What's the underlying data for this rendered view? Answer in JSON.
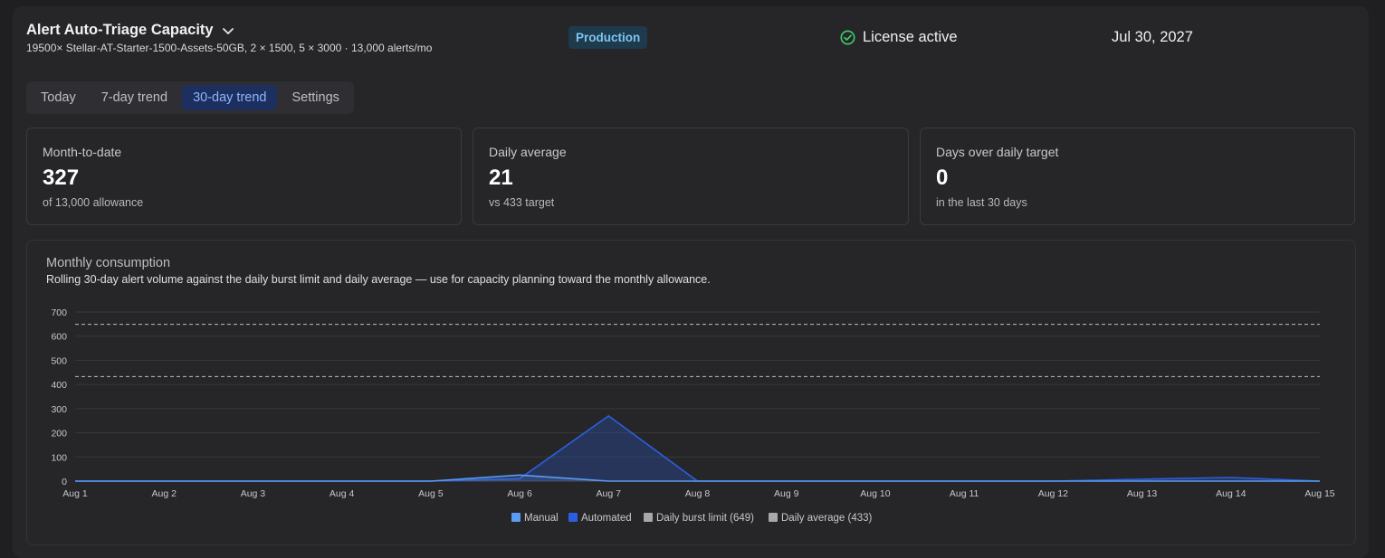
{
  "header": {
    "title": "Alert Auto-Triage Capacity",
    "subtitle": "19500× Stellar-AT-Starter-1500-Assets-50GB, 2 × 1500, 5 × 3000 · 13,000 alerts/mo",
    "environment": "Production",
    "license_status": "License active",
    "date": "Jul 30, 2027"
  },
  "tabs": [
    {
      "label": "Today",
      "active": false
    },
    {
      "label": "7-day trend",
      "active": false
    },
    {
      "label": "30-day trend",
      "active": true
    },
    {
      "label": "Settings",
      "active": false
    }
  ],
  "stats": [
    {
      "label": "Month-to-date",
      "value": "327",
      "note": "of 13,000 allowance"
    },
    {
      "label": "Daily average",
      "value": "21",
      "note": "vs 433 target"
    },
    {
      "label": "Days over daily target",
      "value": "0",
      "note": "in the last 30 days"
    }
  ],
  "chart": {
    "title": "Monthly consumption",
    "description": "Rolling 30-day alert volume against the daily burst limit and daily average — use for capacity planning toward the monthly allowance."
  },
  "colors": {
    "manual": "#5b9bf3",
    "automated": "#2c5fe0",
    "burst_limit": "#a8a8ac",
    "average": "#a8a8ac"
  },
  "chart_data": {
    "type": "area",
    "categories": [
      "Aug 1",
      "Aug 2",
      "Aug 3",
      "Aug 4",
      "Aug 5",
      "Aug 6",
      "Aug 7",
      "Aug 8",
      "Aug 9",
      "Aug 10",
      "Aug 11",
      "Aug 12",
      "Aug 13",
      "Aug 14",
      "Aug 15"
    ],
    "series": [
      {
        "name": "Manual",
        "values": [
          0,
          0,
          0,
          0,
          0,
          25,
          0,
          0,
          0,
          0,
          0,
          0,
          0,
          0,
          0
        ]
      },
      {
        "name": "Automated",
        "values": [
          0,
          0,
          0,
          0,
          0,
          10,
          270,
          0,
          0,
          0,
          0,
          0,
          8,
          15,
          0
        ]
      }
    ],
    "reference_lines": [
      {
        "name": "Daily burst limit (649)",
        "value": 649
      },
      {
        "name": "Daily average (433)",
        "value": 433
      }
    ],
    "yticks": [
      0,
      100,
      200,
      300,
      400,
      500,
      600,
      700
    ],
    "ylim": [
      0,
      700
    ],
    "legend_position": "bottom",
    "grid": true
  }
}
